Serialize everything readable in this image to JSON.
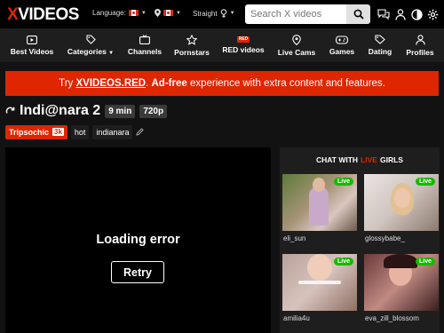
{
  "header": {
    "logo_x": "X",
    "logo_rest": "VIDEOS",
    "language_label": "Language:",
    "straight_label": "Straight",
    "search_placeholder": "Search X videos"
  },
  "nav": {
    "items": [
      {
        "label": "Best Videos",
        "icon": "play-box-icon"
      },
      {
        "label": "Categories",
        "icon": "tag-icon"
      },
      {
        "label": "Channels",
        "icon": "tv-icon"
      },
      {
        "label": "Pornstars",
        "icon": "star-icon"
      },
      {
        "label": "RED videos",
        "icon": "red-badge",
        "badge": "RED"
      },
      {
        "label": "Live Cams",
        "icon": "location-icon"
      },
      {
        "label": "Games",
        "icon": "gamepad-icon"
      },
      {
        "label": "Dating",
        "icon": "tag-heart-icon"
      },
      {
        "label": "Profiles",
        "icon": "user-icon"
      }
    ]
  },
  "banner": {
    "prefix": "Try",
    "brand": "XVIDEOS.RED",
    "adfree": "Ad-free",
    "suffix": "experience with extra content and features."
  },
  "video": {
    "title": "Indi@nara 2",
    "duration": "9 min",
    "quality": "720p",
    "model_tag": "Tripsochic",
    "model_count": "3k",
    "tags": [
      "hot",
      "indianara"
    ],
    "error_text": "Loading error",
    "retry_label": "Retry"
  },
  "chat": {
    "heading_pre": "CHAT WITH",
    "heading_live": "LIVE",
    "heading_post": "GIRLS",
    "live_label": "Live",
    "cams": [
      {
        "name": "eli_sun"
      },
      {
        "name": "glossybabe_"
      },
      {
        "name": "amilia4u"
      },
      {
        "name": "eva_zill_blossom"
      }
    ]
  },
  "colors": {
    "accent": "#de2600",
    "live_green": "#1bb800",
    "background": "#121212"
  }
}
